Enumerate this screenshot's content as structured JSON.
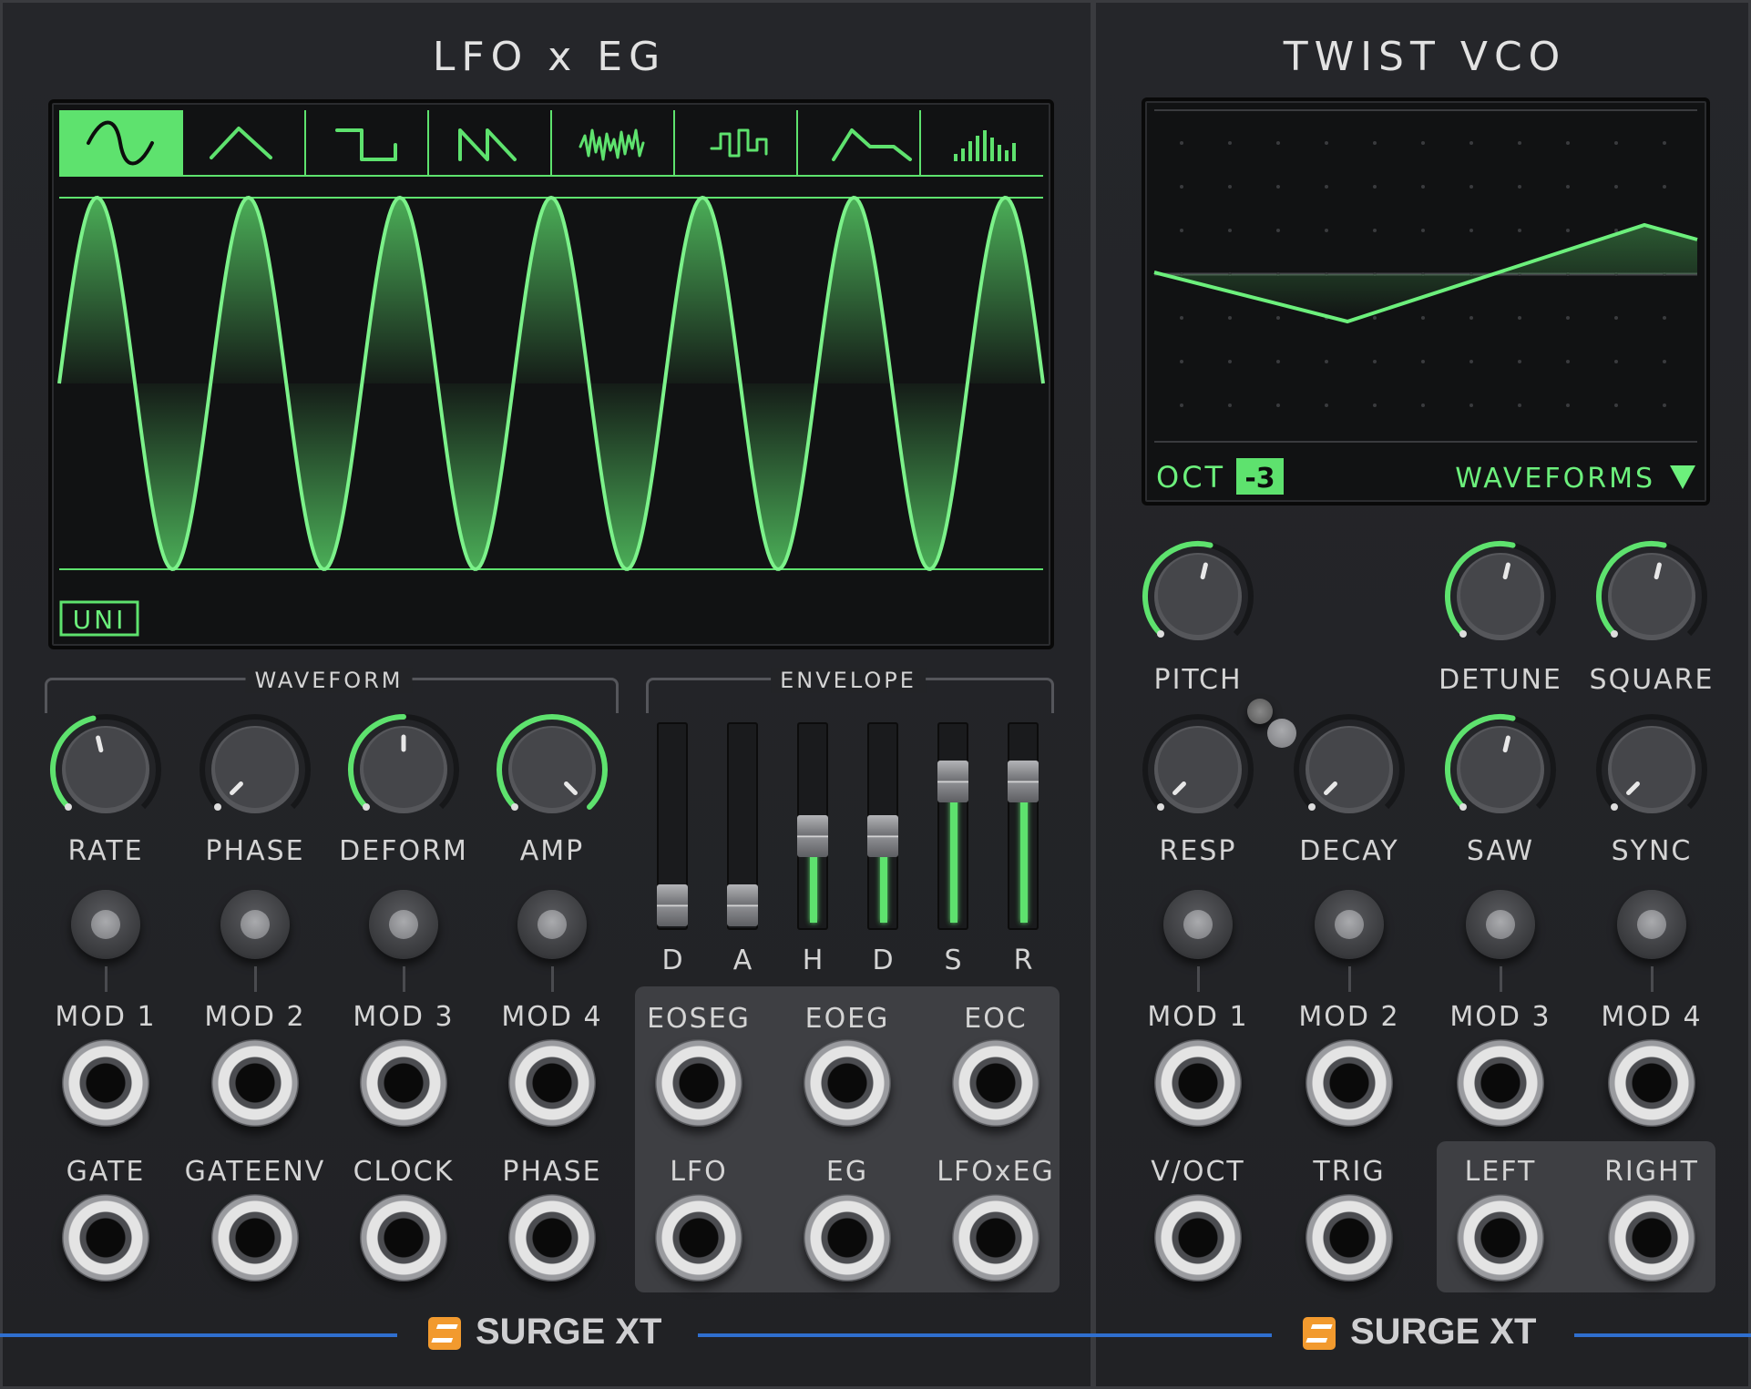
{
  "lfo": {
    "title": "LFO x EG",
    "waveform_section": "WAVEFORM",
    "envelope_section": "ENVELOPE",
    "unipolar_label": "UNI",
    "selected_shape": "sine",
    "shape_icons": [
      "sine-icon",
      "triangle-icon",
      "square-icon",
      "saw-icon",
      "noise-icon",
      "sample-hold-icon",
      "envelope-icon",
      "stepseq-icon"
    ],
    "knobs": [
      {
        "label": "RATE",
        "value": 0.45,
        "modulated": true
      },
      {
        "label": "PHASE",
        "value": 0.0,
        "modulated": false
      },
      {
        "label": "DEFORM",
        "value": 0.5,
        "modulated": true
      },
      {
        "label": "AMP",
        "value": 1.0,
        "modulated": true
      }
    ],
    "mod_labels": [
      "MOD 1",
      "MOD 2",
      "MOD 3",
      "MOD 4"
    ],
    "input_labels": [
      "GATE",
      "GATEENV",
      "CLOCK",
      "PHASE"
    ],
    "sliders": [
      {
        "label": "D",
        "value": 0.0
      },
      {
        "label": "A",
        "value": 0.0
      },
      {
        "label": "H",
        "value": 0.45
      },
      {
        "label": "D",
        "value": 0.45
      },
      {
        "label": "S",
        "value": 0.8
      },
      {
        "label": "R",
        "value": 0.8
      }
    ],
    "trigger_outputs": [
      "EOSEG",
      "EOEG",
      "EOC"
    ],
    "signal_outputs": [
      "LFO",
      "EG",
      "LFOxEG"
    ]
  },
  "vco": {
    "title": "TWIST VCO",
    "octave_label": "OCT",
    "octave_value": "-3",
    "waveforms_label": "WAVEFORMS",
    "knobs_row1": [
      {
        "label": "PITCH",
        "value": 0.55,
        "modulated": true
      },
      {
        "label": "DETUNE",
        "value": 0.55,
        "modulated": true
      },
      {
        "label": "SQUARE",
        "value": 0.55,
        "modulated": true
      }
    ],
    "knobs_row2": [
      {
        "label": "RESP",
        "value": 0.0,
        "modulated": false
      },
      {
        "label": "DECAY",
        "value": 0.0,
        "modulated": false
      },
      {
        "label": "SAW",
        "value": 0.55,
        "modulated": true
      },
      {
        "label": "SYNC",
        "value": 0.0,
        "modulated": false
      }
    ],
    "mod_labels": [
      "MOD 1",
      "MOD 2",
      "MOD 3",
      "MOD 4"
    ],
    "input_labels": [
      "V/OCT",
      "TRIG"
    ],
    "output_labels": [
      "LEFT",
      "RIGHT"
    ]
  },
  "brand": {
    "name": "SURGE XT"
  },
  "colors": {
    "accent": "#5ee26e",
    "panel": "#232427",
    "brand_line": "#2f6fcf",
    "logo": "#f29a2e"
  }
}
